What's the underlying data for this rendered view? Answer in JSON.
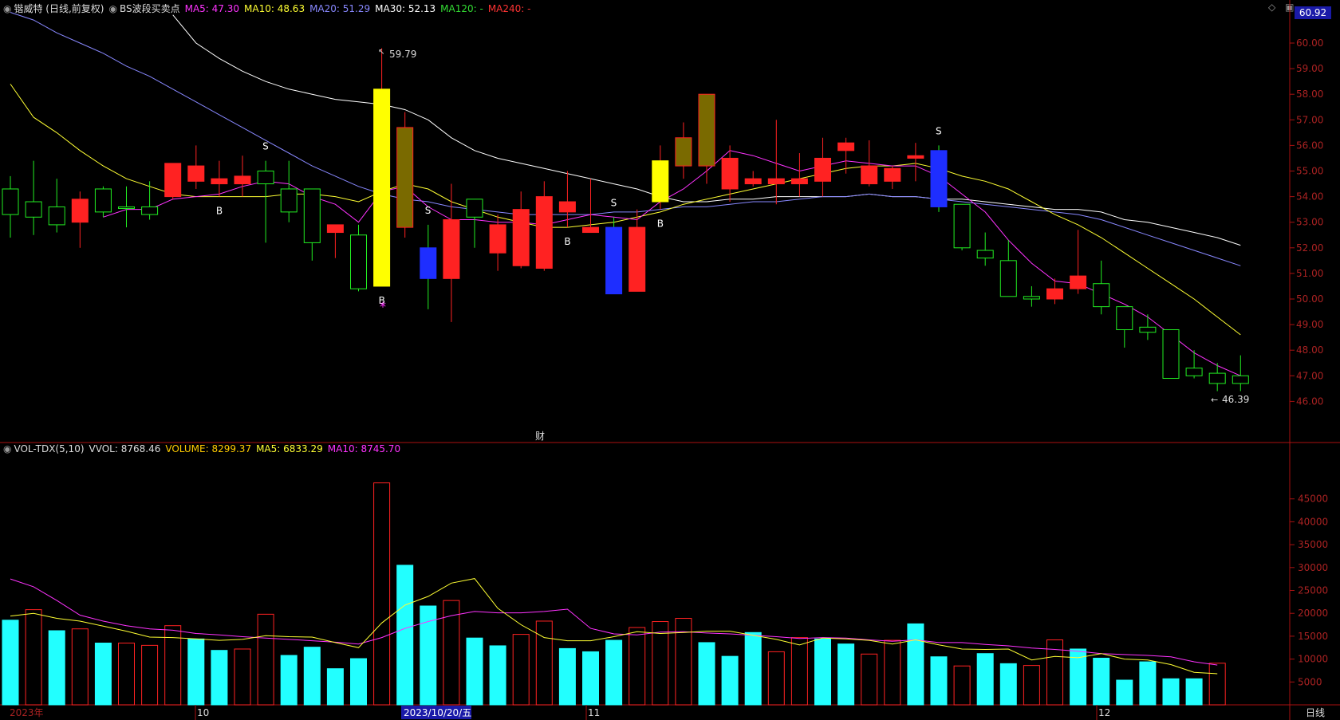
{
  "header": {
    "dot_icon": "circle-dot-icon",
    "title": "锴威特 (日线,前复权)",
    "indicator": "BS波段买卖点",
    "ma5": "MA5: 47.30",
    "ma10": "MA10: 48.63",
    "ma20": "MA20: 51.29",
    "ma30": "MA30: 52.13",
    "ma120": "MA120: -",
    "ma240": "MA240: -",
    "colors": {
      "ma5": "#ff33ff",
      "ma10": "#ffff33",
      "ma20": "#8888ff",
      "ma30": "#ffffff",
      "ma120": "#33dd33",
      "ma240": "#ff3333"
    }
  },
  "price_axis": {
    "current_price": "60.92",
    "ticks": [
      "60.00",
      "59.00",
      "58.00",
      "57.00",
      "56.00",
      "55.00",
      "54.00",
      "53.00",
      "52.00",
      "51.00",
      "50.00",
      "49.00",
      "48.00",
      "47.00",
      "46.00"
    ]
  },
  "vol_header": {
    "label": "VOL-TDX(5,10)",
    "vvol": "VVOL: 8768.46",
    "volume": "VOLUME: 8299.37",
    "ma5": "MA5: 6833.29",
    "ma10": "MA10: 8745.70"
  },
  "vol_axis": {
    "ticks": [
      "45000",
      "40000",
      "35000",
      "30000",
      "25000",
      "20000",
      "15000",
      "10000",
      "5000"
    ]
  },
  "date_axis": {
    "labels": [
      "2023年",
      "10",
      "2023/10/20/五",
      "11",
      "12"
    ],
    "period": "日线"
  },
  "annotations": {
    "high_label": "59.79",
    "low_label": "46.39",
    "finance_marker": "财",
    "star": "*"
  },
  "chart_data": {
    "type": "candlestick",
    "candles": [
      {
        "o": 54.3,
        "h": 54.8,
        "l": 52.4,
        "c": 53.3,
        "up": false
      },
      {
        "o": 53.8,
        "h": 55.4,
        "l": 52.5,
        "c": 53.2,
        "up": false
      },
      {
        "o": 53.6,
        "h": 54.7,
        "l": 52.6,
        "c": 52.9,
        "up": false
      },
      {
        "o": 53.0,
        "h": 54.2,
        "l": 52.0,
        "c": 53.9,
        "up": true
      },
      {
        "o": 54.3,
        "h": 54.4,
        "l": 53.2,
        "c": 53.4,
        "up": false
      },
      {
        "o": 53.6,
        "h": 54.4,
        "l": 52.8,
        "c": 53.6,
        "up": false
      },
      {
        "o": 53.3,
        "h": 54.6,
        "l": 53.1,
        "c": 53.6,
        "up": false
      },
      {
        "o": 54.0,
        "h": 55.3,
        "l": 53.9,
        "c": 55.3,
        "up": true
      },
      {
        "o": 54.6,
        "h": 56.0,
        "l": 54.3,
        "c": 55.2,
        "up": true
      },
      {
        "o": 54.7,
        "h": 55.4,
        "l": 54.0,
        "c": 54.5,
        "up": true
      },
      {
        "o": 54.5,
        "h": 55.6,
        "l": 54.0,
        "c": 54.8,
        "up": true
      },
      {
        "o": 55.0,
        "h": 55.4,
        "l": 52.2,
        "c": 54.5,
        "up": false
      },
      {
        "o": 54.3,
        "h": 55.4,
        "l": 53.0,
        "c": 53.4,
        "up": false
      },
      {
        "o": 54.3,
        "h": 54.3,
        "l": 51.5,
        "c": 52.2,
        "up": false
      },
      {
        "o": 52.9,
        "h": 52.9,
        "l": 51.6,
        "c": 52.6,
        "up": true
      },
      {
        "o": 52.5,
        "h": 52.9,
        "l": 50.3,
        "c": 50.4,
        "up": false
      },
      {
        "o": 50.5,
        "h": 59.8,
        "l": 50.5,
        "c": 58.2,
        "up": true
      },
      {
        "o": 56.7,
        "h": 57.3,
        "l": 52.4,
        "c": 52.8,
        "up": true
      },
      {
        "o": 52.0,
        "h": 52.9,
        "l": 49.6,
        "c": 50.8,
        "up": false
      },
      {
        "o": 50.8,
        "h": 54.5,
        "l": 49.1,
        "c": 53.1,
        "up": true
      },
      {
        "o": 53.9,
        "h": 53.9,
        "l": 52.0,
        "c": 53.2,
        "up": false
      },
      {
        "o": 52.9,
        "h": 53.3,
        "l": 51.1,
        "c": 51.8,
        "up": true
      },
      {
        "o": 51.3,
        "h": 54.2,
        "l": 51.2,
        "c": 53.5,
        "up": true
      },
      {
        "o": 51.2,
        "h": 54.6,
        "l": 51.1,
        "c": 54.0,
        "up": true
      },
      {
        "o": 53.4,
        "h": 55.0,
        "l": 52.8,
        "c": 53.8,
        "up": true
      },
      {
        "o": 52.8,
        "h": 54.7,
        "l": 52.6,
        "c": 52.6,
        "up": true
      },
      {
        "o": 52.8,
        "h": 53.2,
        "l": 50.2,
        "c": 50.2,
        "up": false
      },
      {
        "o": 50.3,
        "h": 53.5,
        "l": 50.3,
        "c": 52.8,
        "up": true
      },
      {
        "o": 53.8,
        "h": 56.0,
        "l": 53.5,
        "c": 55.4,
        "up": true
      },
      {
        "o": 55.2,
        "h": 56.9,
        "l": 54.7,
        "c": 56.3,
        "up": true
      },
      {
        "o": 55.2,
        "h": 58.0,
        "l": 54.5,
        "c": 58.0,
        "up": true
      },
      {
        "o": 54.3,
        "h": 56.0,
        "l": 53.8,
        "c": 55.5,
        "up": true
      },
      {
        "o": 54.5,
        "h": 55.0,
        "l": 54.4,
        "c": 54.7,
        "up": true
      },
      {
        "o": 54.5,
        "h": 57.0,
        "l": 53.7,
        "c": 54.7,
        "up": true
      },
      {
        "o": 54.5,
        "h": 55.7,
        "l": 54.0,
        "c": 54.7,
        "up": true
      },
      {
        "o": 54.6,
        "h": 56.3,
        "l": 54.0,
        "c": 55.5,
        "up": true
      },
      {
        "o": 55.8,
        "h": 56.3,
        "l": 54.9,
        "c": 56.1,
        "up": true
      },
      {
        "o": 54.5,
        "h": 56.2,
        "l": 54.4,
        "c": 55.2,
        "up": true
      },
      {
        "o": 54.6,
        "h": 55.2,
        "l": 54.3,
        "c": 55.1,
        "up": true
      },
      {
        "o": 55.5,
        "h": 56.1,
        "l": 54.6,
        "c": 55.6,
        "up": true
      },
      {
        "o": 55.8,
        "h": 56.0,
        "l": 53.4,
        "c": 53.6,
        "up": false
      },
      {
        "o": 53.7,
        "h": 53.7,
        "l": 51.9,
        "c": 52.0,
        "up": false
      },
      {
        "o": 51.6,
        "h": 52.6,
        "l": 51.3,
        "c": 51.9,
        "up": false
      },
      {
        "o": 51.5,
        "h": 52.3,
        "l": 50.1,
        "c": 50.1,
        "up": false
      },
      {
        "o": 50.1,
        "h": 50.5,
        "l": 49.7,
        "c": 50.0,
        "up": false
      },
      {
        "o": 50.0,
        "h": 50.8,
        "l": 49.8,
        "c": 50.4,
        "up": true
      },
      {
        "o": 50.4,
        "h": 52.7,
        "l": 50.2,
        "c": 50.9,
        "up": true
      },
      {
        "o": 50.6,
        "h": 51.5,
        "l": 49.4,
        "c": 49.7,
        "up": false
      },
      {
        "o": 49.7,
        "h": 49.7,
        "l": 48.1,
        "c": 48.8,
        "up": false
      },
      {
        "o": 48.9,
        "h": 49.4,
        "l": 48.4,
        "c": 48.7,
        "up": false
      },
      {
        "o": 48.8,
        "h": 48.8,
        "l": 46.9,
        "c": 46.9,
        "up": false
      },
      {
        "o": 47.3,
        "h": 48.0,
        "l": 46.9,
        "c": 47.0,
        "up": false
      },
      {
        "o": 47.1,
        "h": 47.5,
        "l": 46.4,
        "c": 46.7,
        "up": false
      },
      {
        "o": 47.0,
        "h": 47.8,
        "l": 46.4,
        "c": 46.7,
        "up": false
      }
    ],
    "ma5": [
      null,
      null,
      null,
      null,
      53.2,
      53.5,
      53.5,
      53.9,
      54.0,
      54.1,
      54.4,
      54.6,
      54.5,
      54.0,
      53.7,
      53.0,
      54.2,
      54.4,
      53.6,
      53.1,
      53.1,
      53.0,
      53.0,
      52.9,
      53.1,
      53.3,
      53.2,
      53.1,
      53.8,
      54.3,
      55.0,
      55.8,
      55.6,
      55.3,
      55.0,
      55.2,
      55.4,
      55.3,
      55.2,
      55.2,
      54.8,
      54.1,
      53.4,
      52.3,
      51.4,
      50.7,
      50.6,
      50.2,
      49.8,
      49.3,
      48.6,
      47.9,
      47.4,
      47.0
    ],
    "ma10": [
      58.4,
      57.1,
      56.5,
      55.8,
      55.2,
      54.7,
      54.4,
      54.1,
      54.0,
      54.0,
      54.0,
      54.0,
      54.1,
      54.1,
      54.0,
      53.8,
      54.2,
      54.5,
      54.3,
      53.8,
      53.5,
      53.2,
      53.0,
      52.8,
      52.8,
      52.9,
      53.0,
      53.2,
      53.4,
      53.7,
      53.9,
      54.1,
      54.3,
      54.5,
      54.7,
      54.9,
      55.1,
      55.2,
      55.2,
      55.3,
      55.1,
      54.8,
      54.6,
      54.3,
      53.8,
      53.3,
      52.9,
      52.4,
      51.8,
      51.2,
      50.6,
      50.0,
      49.3,
      48.6
    ],
    "ma20": [
      61.2,
      60.9,
      60.4,
      60.0,
      59.6,
      59.1,
      58.7,
      58.2,
      57.7,
      57.2,
      56.7,
      56.2,
      55.7,
      55.2,
      54.8,
      54.4,
      54.1,
      53.9,
      53.8,
      53.6,
      53.5,
      53.4,
      53.3,
      53.3,
      53.3,
      53.3,
      53.4,
      53.4,
      53.5,
      53.6,
      53.6,
      53.7,
      53.8,
      53.8,
      53.9,
      54.0,
      54.0,
      54.1,
      54.0,
      54.0,
      53.9,
      53.8,
      53.7,
      53.6,
      53.5,
      53.4,
      53.3,
      53.1,
      52.8,
      52.5,
      52.2,
      51.9,
      51.6,
      51.3
    ],
    "ma30": [
      null,
      null,
      null,
      null,
      null,
      null,
      null,
      61.1,
      60.0,
      59.4,
      58.9,
      58.5,
      58.2,
      58.0,
      57.8,
      57.7,
      57.6,
      57.4,
      57.0,
      56.3,
      55.8,
      55.5,
      55.3,
      55.1,
      54.9,
      54.7,
      54.5,
      54.3,
      54.0,
      53.8,
      53.8,
      53.9,
      53.9,
      54.0,
      54.0,
      54.0,
      54.0,
      54.1,
      54.0,
      54.0,
      53.9,
      53.9,
      53.8,
      53.7,
      53.6,
      53.5,
      53.5,
      53.4,
      53.1,
      53.0,
      52.8,
      52.6,
      52.4,
      52.1
    ],
    "signals": [
      {
        "i": 9,
        "type": "B"
      },
      {
        "i": 11,
        "type": "S"
      },
      {
        "i": 16,
        "type": "B"
      },
      {
        "i": 18,
        "type": "S"
      },
      {
        "i": 24,
        "type": "B"
      },
      {
        "i": 26,
        "type": "S"
      },
      {
        "i": 28,
        "type": "B"
      },
      {
        "i": 40,
        "type": "S"
      }
    ],
    "volume": {
      "values": [
        18500,
        20800,
        16200,
        16600,
        13500,
        13500,
        13000,
        17300,
        14400,
        11900,
        12200,
        19800,
        10800,
        12600,
        7900,
        10100,
        48500,
        30500,
        21600,
        22800,
        14600,
        12900,
        15400,
        18300,
        12300,
        11600,
        14100,
        16900,
        18200,
        18900,
        13600,
        10600,
        15800,
        11600,
        14700,
        14400,
        13300,
        11100,
        14100,
        17700,
        10500,
        8500,
        11200,
        9000,
        8600,
        14200,
        12200,
        10200,
        5400,
        9400,
        5700,
        5700,
        9100
      ],
      "up": [
        false,
        true,
        false,
        true,
        false,
        true,
        true,
        true,
        false,
        false,
        true,
        true,
        false,
        false,
        false,
        false,
        true,
        false,
        false,
        true,
        false,
        false,
        true,
        true,
        false,
        false,
        false,
        true,
        true,
        true,
        false,
        false,
        false,
        true,
        true,
        false,
        false,
        true,
        true,
        false,
        false,
        true,
        false,
        false,
        true,
        true,
        false,
        false,
        false,
        false,
        false,
        false,
        true
      ],
      "ma5": [
        19400,
        20000,
        18900,
        18300,
        17200,
        16100,
        14800,
        14700,
        14400,
        14100,
        14300,
        15100,
        14900,
        14800,
        13600,
        12500,
        17900,
        21800,
        23700,
        26600,
        27600,
        21100,
        17500,
        14700,
        14000,
        14000,
        14900,
        16000,
        15600,
        15800,
        16100,
        16100,
        15200,
        14300,
        13100,
        14600,
        14400,
        14100,
        13300,
        14200,
        13100,
        12200,
        12100,
        12200,
        9800,
        10600,
        10300,
        11200,
        10000,
        9800,
        8800,
        7100,
        6800
      ],
      "ma10": [
        27500,
        25800,
        22800,
        19600,
        18300,
        17300,
        16600,
        16300,
        15600,
        15300,
        14900,
        14600,
        14300,
        14000,
        13700,
        13300,
        14700,
        16700,
        18200,
        19500,
        20400,
        20100,
        20100,
        20400,
        20900,
        16700,
        15500,
        15300,
        15900,
        16000,
        15700,
        15500,
        15200,
        14900,
        14500,
        14700,
        14600,
        14200,
        13900,
        14200,
        13600,
        13600,
        13200,
        12900,
        12400,
        12100,
        11700,
        11200,
        11000,
        10800,
        10500,
        9400,
        8700
      ]
    }
  }
}
